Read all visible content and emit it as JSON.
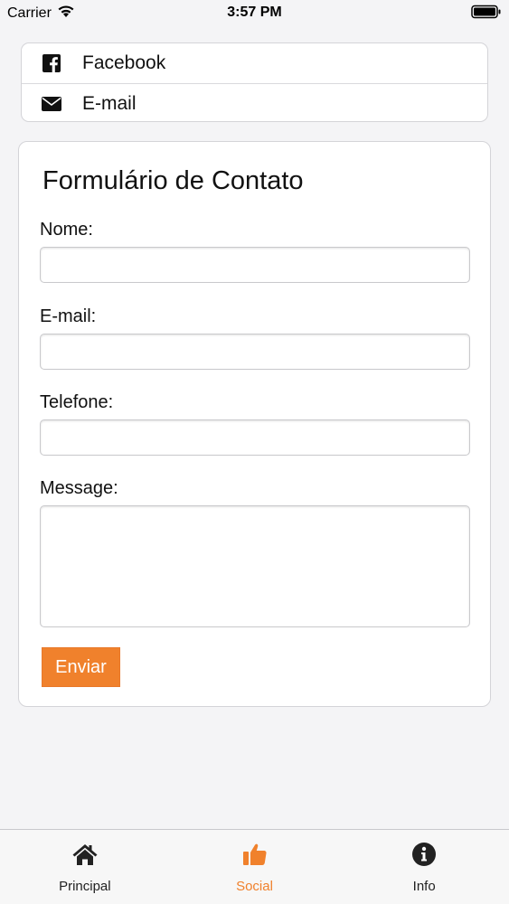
{
  "status_bar": {
    "carrier": "Carrier",
    "time": "3:57 PM",
    "icons": [
      "wifi-icon",
      "battery-icon"
    ]
  },
  "social": {
    "items": [
      {
        "label": "Facebook",
        "icon": "facebook-icon"
      },
      {
        "label": "E-mail",
        "icon": "envelope-icon"
      }
    ]
  },
  "form": {
    "title": "Formulário de Contato",
    "fields": [
      {
        "label": "Nome:",
        "value": "",
        "placeholder": ""
      },
      {
        "label": "E-mail:",
        "value": "",
        "placeholder": ""
      },
      {
        "label": "Telefone:",
        "value": "",
        "placeholder": ""
      },
      {
        "label": "Message:",
        "value": "",
        "placeholder": ""
      }
    ],
    "submit_label": "Enviar"
  },
  "tab_bar": {
    "tabs": [
      {
        "label": "Principal",
        "icon": "home-icon",
        "active": false
      },
      {
        "label": "Social",
        "icon": "thumbs-up-icon",
        "active": true
      },
      {
        "label": "Info",
        "icon": "info-icon",
        "active": false
      }
    ]
  },
  "colors": {
    "accent": "#f0812c",
    "background": "#f4f4f6",
    "card": "#ffffff"
  }
}
